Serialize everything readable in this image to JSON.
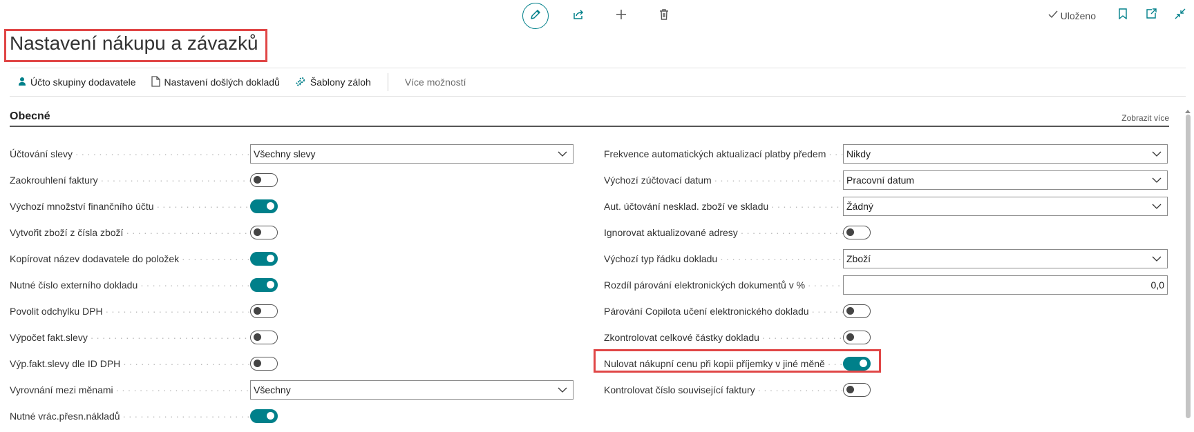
{
  "page": {
    "title": "Nastavení nákupu a závazků",
    "saved_label": "Uloženo"
  },
  "toolbar": {
    "icons": [
      "edit-pencil-icon",
      "share-icon",
      "plus-icon",
      "delete-trash-icon"
    ],
    "right_icons": [
      "bookmark-icon",
      "open-new-window-icon",
      "collapse-icon"
    ]
  },
  "actions": [
    {
      "label": "Účto skupiny dodavatele",
      "icon": "person-icon"
    },
    {
      "label": "Nastavení došlých dokladů",
      "icon": "document-icon"
    },
    {
      "label": "Šablony záloh",
      "icon": "gears-icon"
    },
    {
      "label": "Více možností"
    }
  ],
  "section": {
    "title": "Obecné",
    "show_more": "Zobrazit více"
  },
  "left_fields": [
    {
      "label": "Účtování slevy",
      "type": "select",
      "value": "Všechny slevy"
    },
    {
      "label": "Zaokrouhlení faktury",
      "type": "toggle",
      "on": false
    },
    {
      "label": "Výchozí množství finančního účtu",
      "type": "toggle",
      "on": true
    },
    {
      "label": "Vytvořit zboží z čísla zboží",
      "type": "toggle",
      "on": false
    },
    {
      "label": "Kopírovat název dodavatele do položek",
      "type": "toggle",
      "on": true
    },
    {
      "label": "Nutné číslo externího dokladu",
      "type": "toggle",
      "on": true
    },
    {
      "label": "Povolit odchylku DPH",
      "type": "toggle",
      "on": false
    },
    {
      "label": "Výpočet fakt.slevy",
      "type": "toggle",
      "on": false
    },
    {
      "label": "Výp.fakt.slevy dle ID DPH",
      "type": "toggle",
      "on": false
    },
    {
      "label": "Vyrovnání mezi měnami",
      "type": "select",
      "value": "Všechny"
    },
    {
      "label": "Nutné vrác.přesn.nákladů",
      "type": "toggle",
      "on": true
    }
  ],
  "right_fields": [
    {
      "label": "Frekvence automatických aktualizací platby předem",
      "type": "select",
      "value": "Nikdy"
    },
    {
      "label": "Výchozí zúčtovací datum",
      "type": "select",
      "value": "Pracovní datum"
    },
    {
      "label": "Aut. účtování nesklad. zboží ve skladu",
      "type": "select",
      "value": "Žádný"
    },
    {
      "label": "Ignorovat aktualizované adresy",
      "type": "toggle",
      "on": false
    },
    {
      "label": "Výchozí typ řádku dokladu",
      "type": "select",
      "value": "Zboží"
    },
    {
      "label": "Rozdíl párování elektronických dokumentů v %",
      "type": "number",
      "value": "0,0"
    },
    {
      "label": "Párování Copilota učení elektronického dokladu",
      "type": "toggle",
      "on": false
    },
    {
      "label": "Zkontrolovat celkové částky dokladu",
      "type": "toggle",
      "on": false
    },
    {
      "label": "Nulovat nákupní cenu při kopii příjemky v jiné měně",
      "type": "toggle",
      "on": true
    },
    {
      "label": "Kontrolovat číslo související faktury",
      "type": "toggle",
      "on": false
    }
  ],
  "colors": {
    "accent": "#00808a",
    "highlight": "#e04646"
  }
}
